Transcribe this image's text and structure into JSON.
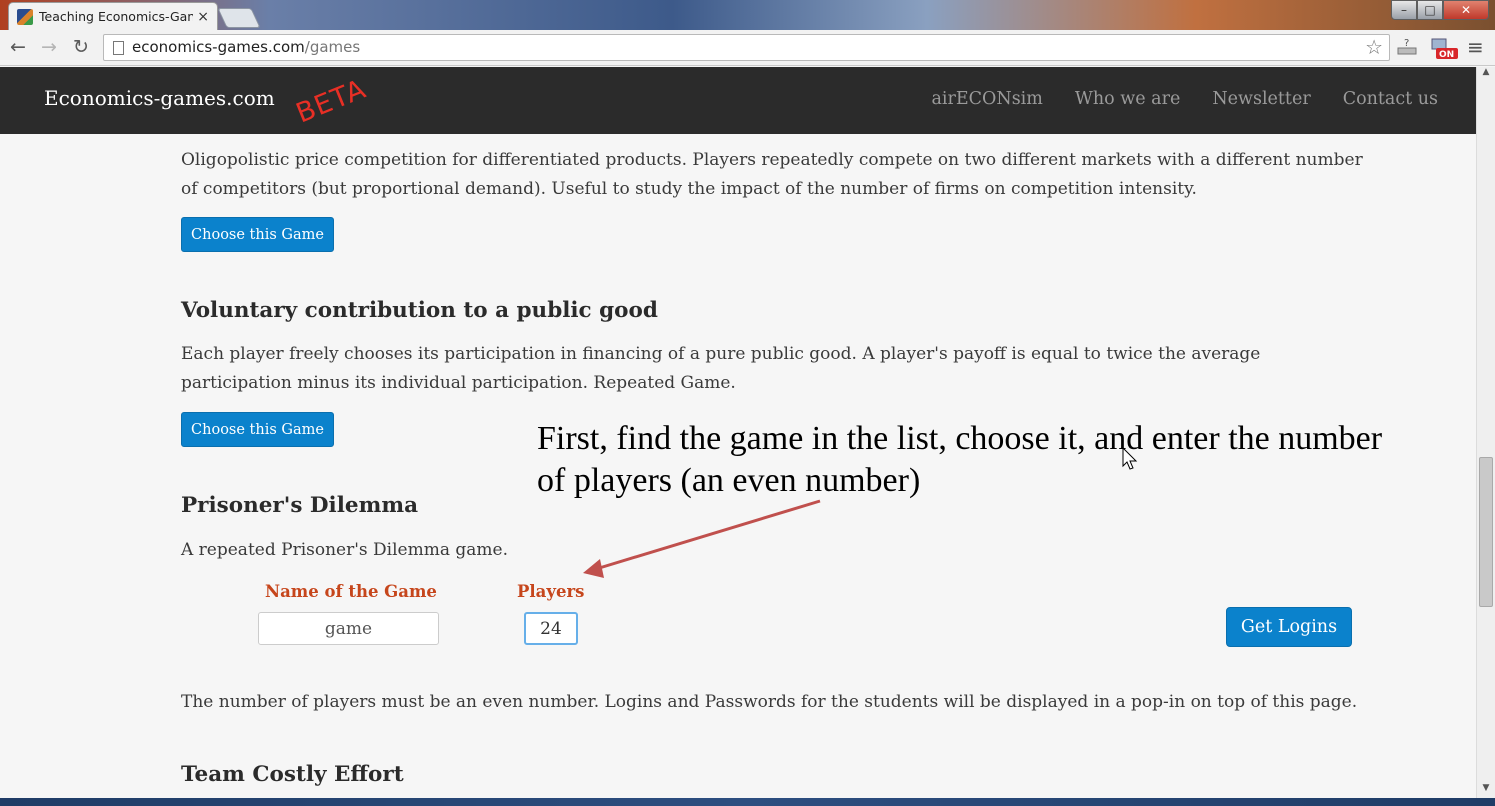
{
  "browser": {
    "tab_title": "Teaching Economics-Gan",
    "tab_close": "×",
    "url_host": "economics-games.com",
    "url_path": "/games",
    "back": "←",
    "forward": "→",
    "reload": "↻",
    "star": "☆",
    "menu": "≡",
    "window_min": "–",
    "window_max": "□",
    "window_close": "✕"
  },
  "site": {
    "brand": "Economics-games.com",
    "beta": "BETA",
    "nav": [
      "airECONsim",
      "Who we are",
      "Newsletter",
      "Contact us"
    ]
  },
  "games": {
    "oligopoly": {
      "description": "Oligopolistic price competition for differentiated products. Players repeatedly compete on two different markets with a different number of competitors (but proportional demand). Useful to study the impact of the number of firms on competition intensity.",
      "button": "Choose this Game"
    },
    "public_good": {
      "title": "Voluntary contribution to a public good",
      "description": "Each player freely chooses its participation in financing of a pure public good. A player's payoff is equal to twice the average participation minus its individual participation. Repeated Game.",
      "button": "Choose this Game"
    },
    "prisoners": {
      "title": "Prisoner's Dilemma",
      "description": "A repeated Prisoner's Dilemma game.",
      "name_label": "Name of the Game",
      "name_value": "game",
      "players_label": "Players",
      "players_value": "24",
      "logins_button": "Get Logins",
      "note": "The number of players must be an even number. Logins and Passwords for the students will be displayed in a pop-in on top of this page."
    },
    "team": {
      "title": "Team Costly Effort"
    }
  },
  "annotation": {
    "line1": "First, find the game in the list, choose it, and enter the number",
    "line2": "of players (an even number)",
    "arrow_color": "#c0504d"
  }
}
